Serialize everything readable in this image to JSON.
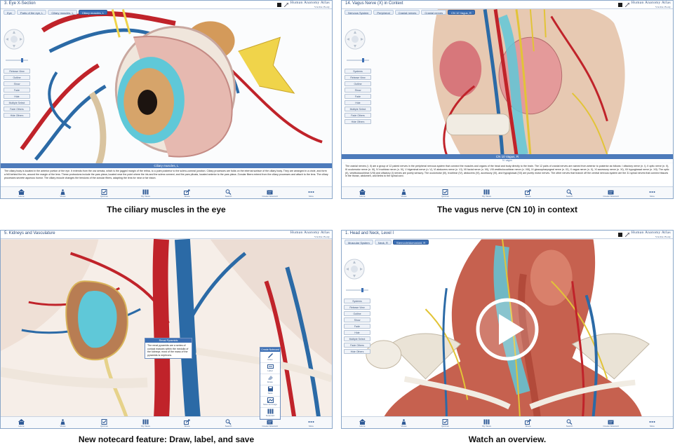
{
  "panels": [
    {
      "title": "3. Eye X-Section",
      "crumbs": [
        "Eye",
        "Parts of the eye, L",
        "Ciliary muscles, L",
        "Ciliary muscles, L"
      ],
      "info_title": "Ciliary muscles, L",
      "info_sub": "",
      "description": "The ciliary body is located in the anterior portion of the eye. It extends from the ora serrata, which is the jagged margin of the retina, to a point posterior to the sclero-corneal junction. Ciliary processes are folds on the internal surface of the ciliary body. They are arranged in a circle, and form a frill behind the iris, around the margin of the lens. These protrusions include the pars plana, located near the point where the iris and the sclera connect, and the pars plicata, located anterior to the pars plana. Zonular fibers extend from the ciliary processes and attach to the lens. The ciliary processes secrete aqueous humor. The ciliary muscle changes the tensions of the zonular fibers, adapting the lens for near or far vision.",
      "caption": "The ciliary muscles in the eye"
    },
    {
      "title": "14. Vagus Nerve (X) in Context",
      "crumbs": [
        "Nervous System",
        "Peripheral",
        "Cranial nerves",
        "Cranial nerves",
        "CN 10 Vagus, R"
      ],
      "info_title": "CN 10 Vagus, R",
      "info_sub": "N. vagus",
      "description": "The cranial nerves (I, II) are a group of 12 paired nerves in the peripheral nervous system that connect the muscles and organs of the head and body directly to the brain. The 12 pairs of cranial nerves are named from anterior to posterior as follows: I olfactory nerve (n. I), II optic nerve (n. II), III oculomotor nerve (n. III), IV trochlear nerve (n. IV), V trigeminal nerve (n. V), VI abducens nerve (n. VI), VII facial nerve (n. VII), VIII vestibulocochlear nerve (n. VIII), IX glossopharyngeal nerve (n. IX), X vagus nerve (n. X), XI accessory nerve (n. XI), XII hypoglossal nerve (n. XII). The optic (II), vestibulocochlear (VIII) and olfactory (I) nerves are purely sensory. The oculomotor (III), trochlear (IV), abducens (VI), accessory (XI), and hypoglossal (XII) are purely motor nerves. The other nerves that branch off the central nervous system are the 31 spinal nerves that connect tissues in the thorax, abdomen, and limbs to the spinal cord.",
      "caption": "The vagus nerve (CN 10) in context"
    },
    {
      "title": "5. Kidneys and Vasculature",
      "crumbs": [],
      "callout_title": "Renal Pyramids",
      "callout_body": "The renal pyramids are a series of conical masses within the medulla of the kidneys; most of the mass of the pyramids is nephrons.",
      "notecard_title": "Create Notecard",
      "note_tools": [
        "Draw",
        "Label",
        "Erase",
        "Save",
        "Save as Image",
        "Notecard"
      ],
      "caption": "New notecard feature: Draw, label, and save"
    },
    {
      "title": "1. Head and Neck, Level I",
      "crumbs": [
        "Muscular System",
        "Neck, R",
        "Sternocleidomastoid, R"
      ],
      "caption": "Watch an overview."
    }
  ],
  "brand": {
    "name": "Human Anatomy Atlas",
    "sub": "Visible Body"
  },
  "toolbar_buttons": [
    "Systems",
    "Release View",
    "Outline",
    "Show",
    "Fade",
    "Hide",
    "Multiple Select",
    "Fade Others",
    "Hide Others"
  ],
  "tabs": [
    "Home",
    "Views",
    "Quizzes",
    "My Views",
    "Share",
    "Search",
    "Create Notecard",
    "More"
  ],
  "colors": {
    "accent": "#3c6fb4",
    "frame": "#8aa7c9",
    "muscle": "#c6614f",
    "nerve": "#e2c437",
    "artery": "#c0232a",
    "vein": "#2b6aa6"
  }
}
